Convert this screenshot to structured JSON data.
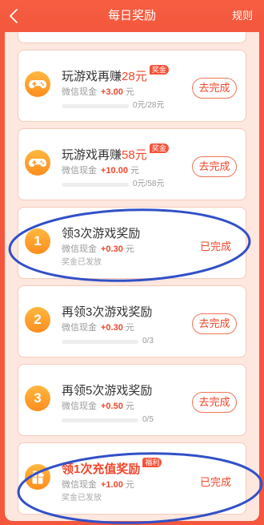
{
  "header": {
    "back_icon": "chevron-left-icon",
    "title": "每日奖励",
    "rules_label": "规则"
  },
  "colors": {
    "brand": "#f4573d",
    "panel": "#fde7de",
    "accent_text": "#f0472c",
    "icon_orange": "#fca12b",
    "annotation_circle": "#3150c8"
  },
  "tasks": [
    {
      "icon": "gamepad-icon",
      "title": "玩游戏再赚",
      "title_highlight": "28元",
      "badge": "奖金",
      "reward_label": "微信现金",
      "reward_value": "+3.00",
      "reward_unit": "元",
      "progress_fraction": 0,
      "progress_text": "0元/28元",
      "action_label": "去完成"
    },
    {
      "icon": "gamepad-icon",
      "title": "玩游戏再赚",
      "title_highlight": "58元",
      "badge": "奖金",
      "reward_label": "微信现金",
      "reward_value": "+10.00",
      "reward_unit": "元",
      "progress_fraction": 0,
      "progress_text": "0元/58元",
      "action_label": "去完成"
    },
    {
      "icon_number": "1",
      "title": "领3次游戏奖励",
      "reward_label": "微信现金",
      "reward_value": "+0.30",
      "reward_unit": "元",
      "note": "奖金已发放",
      "status": "已完成"
    },
    {
      "icon_number": "2",
      "title": "再领3次游戏奖励",
      "reward_label": "微信现金",
      "reward_value": "+0.30",
      "reward_unit": "元",
      "progress_fraction": 0,
      "progress_text": "0/3",
      "action_label": "去完成"
    },
    {
      "icon_number": "3",
      "title": "再领5次游戏奖励",
      "reward_label": "微信现金",
      "reward_value": "+0.50",
      "reward_unit": "元",
      "progress_fraction": 0,
      "progress_text": "0/5",
      "action_label": "去完成"
    },
    {
      "icon": "gift-icon",
      "title": "领1次充值奖励",
      "badge": "福利",
      "reward_label": "微信现金",
      "reward_value": "+1.00",
      "reward_unit": "元",
      "note": "奖金已发放",
      "status": "已完成"
    }
  ]
}
